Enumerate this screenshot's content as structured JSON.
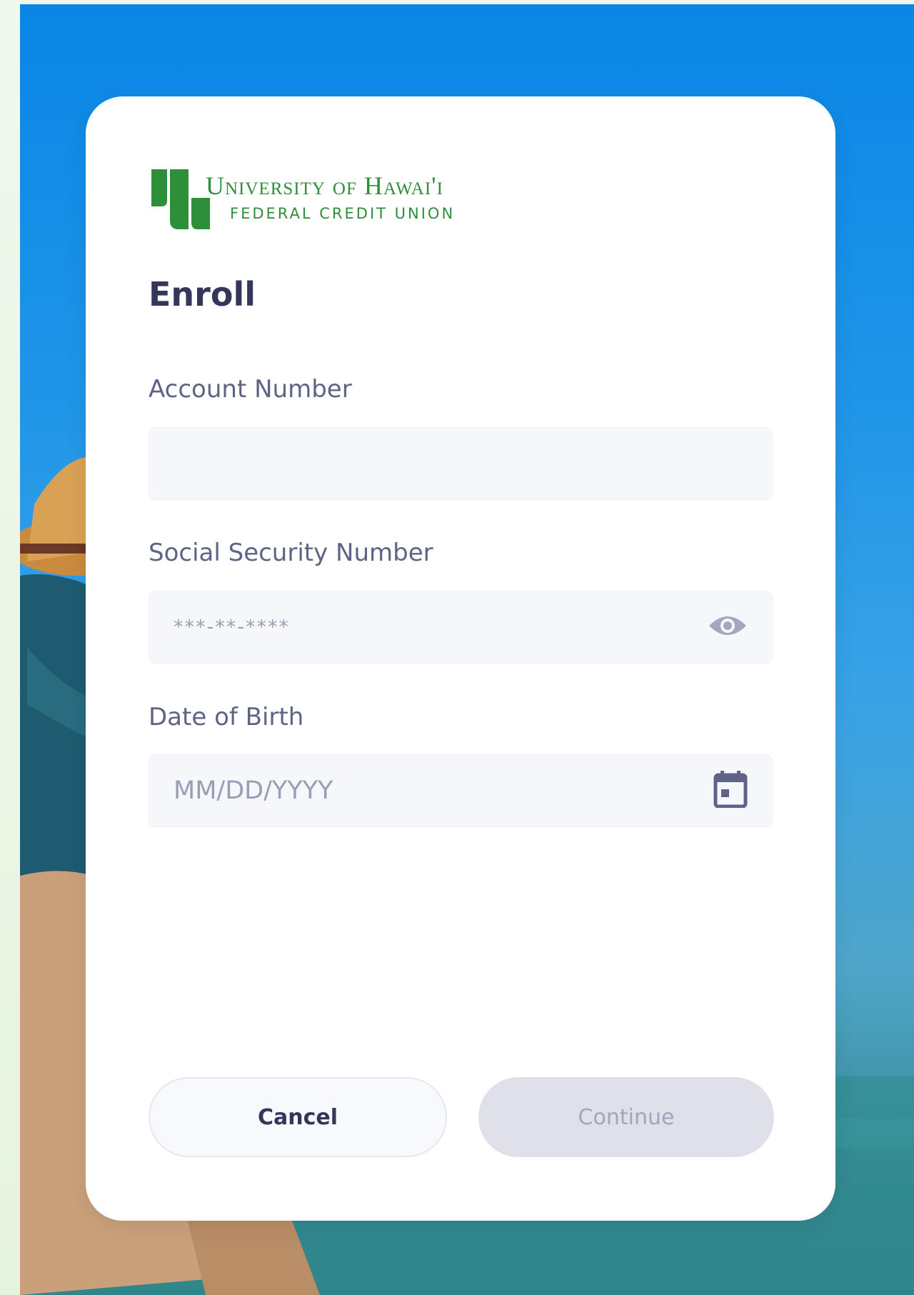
{
  "brand": {
    "name_line1": "University of Hawai'i",
    "name_line2": "FEDERAL CREDIT UNION",
    "color": "#2e8f3a"
  },
  "page": {
    "title": "Enroll"
  },
  "form": {
    "account_number": {
      "label": "Account Number",
      "value": "",
      "placeholder": ""
    },
    "ssn": {
      "label": "Social Security Number",
      "placeholder": "***-**-****",
      "icon": "eye-icon"
    },
    "dob": {
      "label": "Date of Birth",
      "placeholder": "MM/DD/YYYY",
      "icon": "calendar-icon"
    }
  },
  "actions": {
    "cancel_label": "Cancel",
    "continue_label": "Continue",
    "continue_disabled": true
  },
  "colors": {
    "title": "#34375a",
    "label": "#5f6486",
    "field_bg": "#f6f7fb",
    "continue_bg": "#dfe0ea"
  }
}
